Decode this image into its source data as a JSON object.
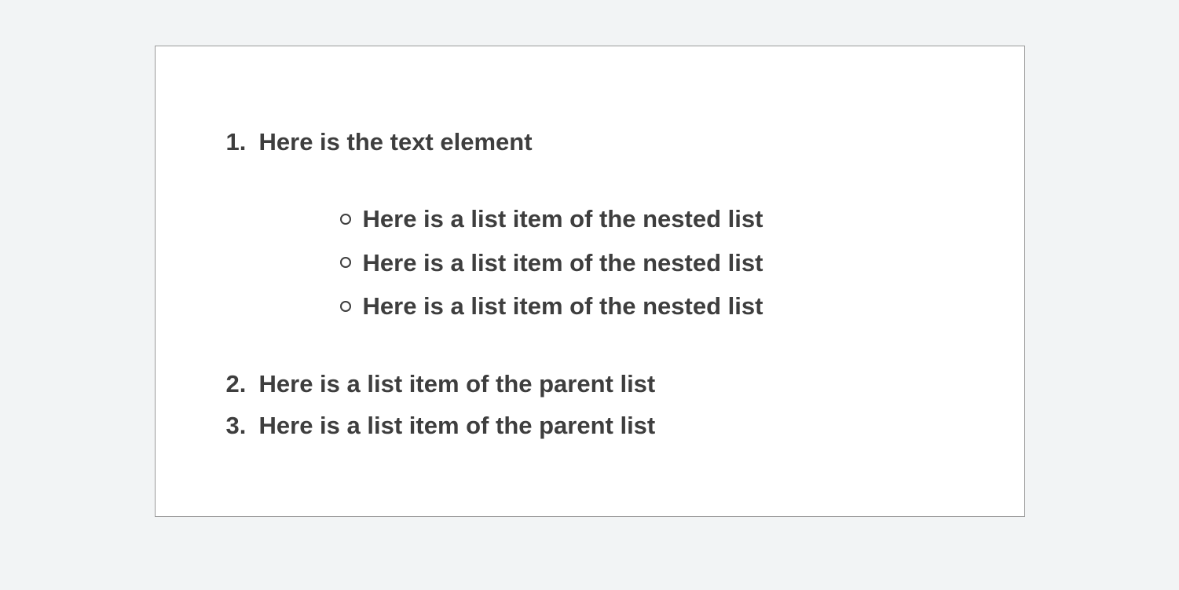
{
  "parent_list": {
    "items": [
      {
        "number": "1.",
        "text": "Here is the text element",
        "nested": [
          "Here is a list item of the nested list",
          "Here is a list item of the nested list",
          "Here is a list item of the nested list"
        ]
      },
      {
        "number": "2.",
        "text": "Here is a list item of the parent list"
      },
      {
        "number": "3.",
        "text": "Here is a list item of the parent list"
      }
    ]
  }
}
